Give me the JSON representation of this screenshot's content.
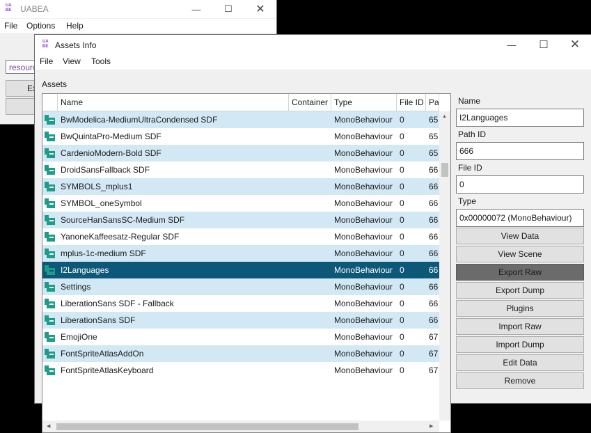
{
  "main_window": {
    "title": "UABEA",
    "logo_top": "UA",
    "logo_bottom": "BE",
    "menu": [
      "File",
      "Options",
      "Help"
    ],
    "input_value": "resourc",
    "button_label": "Ex"
  },
  "assets_window": {
    "title": "Assets Info",
    "logo_top": "UA",
    "logo_bottom": "BE",
    "menu": [
      "File",
      "View",
      "Tools"
    ],
    "section_label": "Assets",
    "columns": [
      "Name",
      "Container",
      "Type",
      "File ID",
      "Pa"
    ],
    "rows": [
      {
        "name": "BwModelica-MediumUltraCondensed SDF",
        "container": "",
        "type": "MonoBehaviour",
        "file_id": "0",
        "path": "65"
      },
      {
        "name": "BwQuintaPro-Medium SDF",
        "container": "",
        "type": "MonoBehaviour",
        "file_id": "0",
        "path": "65"
      },
      {
        "name": "CardenioModern-Bold SDF",
        "container": "",
        "type": "MonoBehaviour",
        "file_id": "0",
        "path": "65"
      },
      {
        "name": "DroidSansFallback SDF",
        "container": "",
        "type": "MonoBehaviour",
        "file_id": "0",
        "path": "66"
      },
      {
        "name": "SYMBOLS_mplus1",
        "container": "",
        "type": "MonoBehaviour",
        "file_id": "0",
        "path": "66"
      },
      {
        "name": "SYMBOL_oneSymbol",
        "container": "",
        "type": "MonoBehaviour",
        "file_id": "0",
        "path": "66"
      },
      {
        "name": "SourceHanSansSC-Medium SDF",
        "container": "",
        "type": "MonoBehaviour",
        "file_id": "0",
        "path": "66"
      },
      {
        "name": "YanoneKaffeesatz-Regular SDF",
        "container": "",
        "type": "MonoBehaviour",
        "file_id": "0",
        "path": "66"
      },
      {
        "name": "mplus-1c-medium SDF",
        "container": "",
        "type": "MonoBehaviour",
        "file_id": "0",
        "path": "66"
      },
      {
        "name": "I2Languages",
        "container": "",
        "type": "MonoBehaviour",
        "file_id": "0",
        "path": "66"
      },
      {
        "name": "Settings",
        "container": "",
        "type": "MonoBehaviour",
        "file_id": "0",
        "path": "66"
      },
      {
        "name": "LiberationSans SDF - Fallback",
        "container": "",
        "type": "MonoBehaviour",
        "file_id": "0",
        "path": "66"
      },
      {
        "name": "LiberationSans SDF",
        "container": "",
        "type": "MonoBehaviour",
        "file_id": "0",
        "path": "66"
      },
      {
        "name": "EmojiOne",
        "container": "",
        "type": "MonoBehaviour",
        "file_id": "0",
        "path": "67"
      },
      {
        "name": "FontSpriteAtlasAddOn",
        "container": "",
        "type": "MonoBehaviour",
        "file_id": "0",
        "path": "67"
      },
      {
        "name": "FontSpriteAtlasKeyboard",
        "container": "",
        "type": "MonoBehaviour",
        "file_id": "0",
        "path": "67"
      }
    ],
    "selected_index": 9,
    "details": {
      "name_label": "Name",
      "name_value": "I2Languages",
      "path_id_label": "Path ID",
      "path_id_value": "666",
      "file_id_label": "File ID",
      "file_id_value": "0",
      "type_label": "Type",
      "type_value": "0x00000072 (MonoBehaviour)"
    },
    "buttons": [
      "View Data",
      "View Scene",
      "Export Raw",
      "Export Dump",
      "Plugins",
      "Import Raw",
      "Import Dump",
      "Edit Data",
      "Remove"
    ],
    "pressed_button": "Export Raw"
  },
  "colors": {
    "selection": "#0d5878",
    "row_alt": "#d2e9f5",
    "icon": "#1f9b8a",
    "logo": "#8a3fd1"
  }
}
